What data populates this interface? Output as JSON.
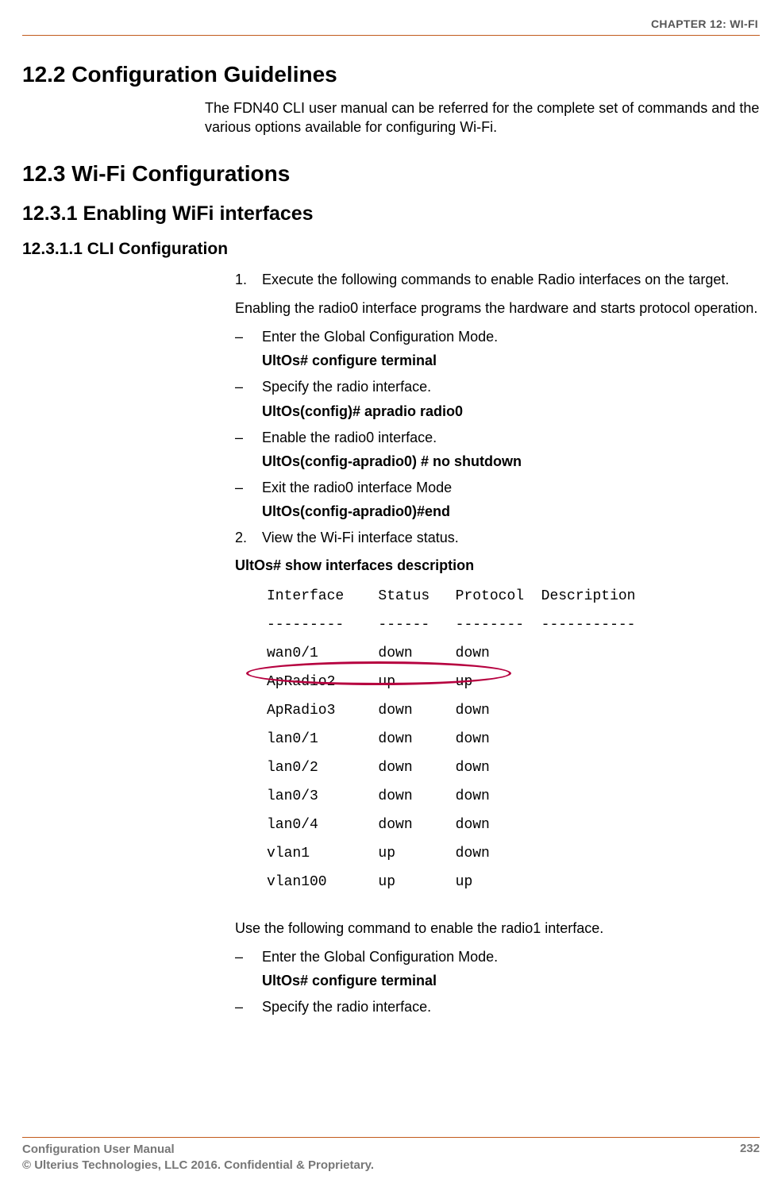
{
  "header": {
    "chapter": "CHAPTER 12: WI-FI"
  },
  "sections": {
    "s12_2": {
      "title": "12.2 Configuration Guidelines",
      "para": "The FDN40 CLI user manual can be referred for the complete set of commands and the various options available for configuring Wi-Fi."
    },
    "s12_3": {
      "title": "12.3 Wi-Fi Configurations"
    },
    "s12_3_1": {
      "title": "12.3.1   Enabling WiFi interfaces"
    },
    "s12_3_1_1": {
      "title": "12.3.1.1   CLI Configuration"
    }
  },
  "steps": {
    "num1": "1.",
    "step1_text": "Execute the following commands to enable Radio interfaces on the target.",
    "step1_para": "Enabling the radio0 interface programs the hardware and starts protocol operation.",
    "d1": {
      "text": "Enter the Global Configuration Mode.",
      "cmd": "UltOs# configure terminal"
    },
    "d2": {
      "text": "Specify the radio interface.",
      "cmd": "UltOs(config)# apradio radio0"
    },
    "d3": {
      "text": "Enable the radio0 interface.",
      "cmd": "UltOs(config-apradio0) # no shutdown"
    },
    "d4": {
      "text": "Exit the radio0 interface Mode",
      "cmd": "UltOs(config-apradio0)#end"
    },
    "num2": "2.",
    "step2_text": "View the Wi-Fi interface status.",
    "step2_cmd": "UltOs# show interfaces description",
    "after_cli": "Use the following command to enable the radio1 interface.",
    "d5": {
      "text": "Enter the Global Configuration Mode.",
      "cmd": "UltOs# configure terminal"
    },
    "d6": {
      "text": "Specify the radio interface."
    }
  },
  "cli": {
    "header": "Interface    Status   Protocol  Description",
    "divider": "---------    ------   --------  -----------",
    "r0": "wan0/1       down     down",
    "r1": "ApRadio2     up       up",
    "r2": "ApRadio3     down     down",
    "r3": "lan0/1       down     down",
    "r4": "lan0/2       down     down",
    "r5": "lan0/3       down     down",
    "r6": "lan0/4       down     down",
    "r7": "vlan1        up       down",
    "r8": "vlan100      up       up"
  },
  "footer": {
    "line1": "Configuration User Manual",
    "line2": "© Ulterius Technologies, LLC 2016. Confidential & Proprietary.",
    "page": "232"
  },
  "dash": "–"
}
